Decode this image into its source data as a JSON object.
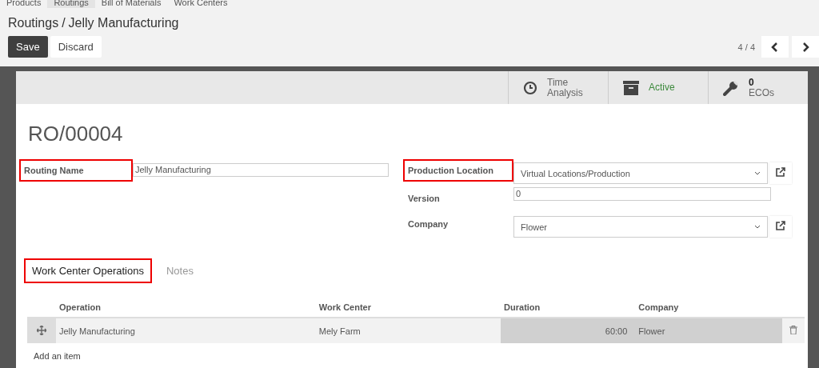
{
  "top_menu": [
    {
      "label": "Products",
      "selected": false
    },
    {
      "label": "Routings",
      "selected": true
    },
    {
      "label": "Bill of Materials",
      "selected": false
    },
    {
      "label": "Work Centers",
      "selected": false
    }
  ],
  "breadcrumb": {
    "parent": "Routings",
    "separator": "/",
    "current": "Jelly Manufacturing"
  },
  "buttons": [
    {
      "label": "Save",
      "kind": "primary"
    },
    {
      "label": "Discard",
      "kind": "secondary"
    }
  ],
  "pager": {
    "text": "4 / 4"
  },
  "button_box": [
    {
      "kind": "clock",
      "lines": [
        "Time",
        "Analysis"
      ]
    },
    {
      "kind": "archive",
      "lines": [
        "Active"
      ]
    },
    {
      "kind": "wrench",
      "lines": [
        "0",
        "ECOs"
      ]
    }
  ],
  "record_title": "RO/00004",
  "left_fields": [
    {
      "label": "Routing Name",
      "value": "Jelly Manufacturing",
      "kind": "text",
      "highlighted": true
    }
  ],
  "right_fields": [
    {
      "label": "Production Location",
      "value": "Virtual Locations/Production",
      "kind": "select",
      "highlighted": true
    },
    {
      "label": "Version",
      "value": "0",
      "kind": "text",
      "highlighted": false
    },
    {
      "label": "Company",
      "value": "Flower",
      "kind": "select",
      "highlighted": false
    }
  ],
  "tabs": [
    {
      "label": "Work Center Operations",
      "selected": true,
      "highlighted": true
    },
    {
      "label": "Notes",
      "selected": false,
      "highlighted": false
    }
  ],
  "table": {
    "columns": [
      "Operation",
      "Work Center",
      "Duration",
      "Company"
    ],
    "rows": [
      {
        "operation": "Jelly Manufacturing",
        "work_center": "Mely Farm",
        "duration": "60:00",
        "company": "Flower"
      }
    ],
    "add_item": "Add an item"
  }
}
